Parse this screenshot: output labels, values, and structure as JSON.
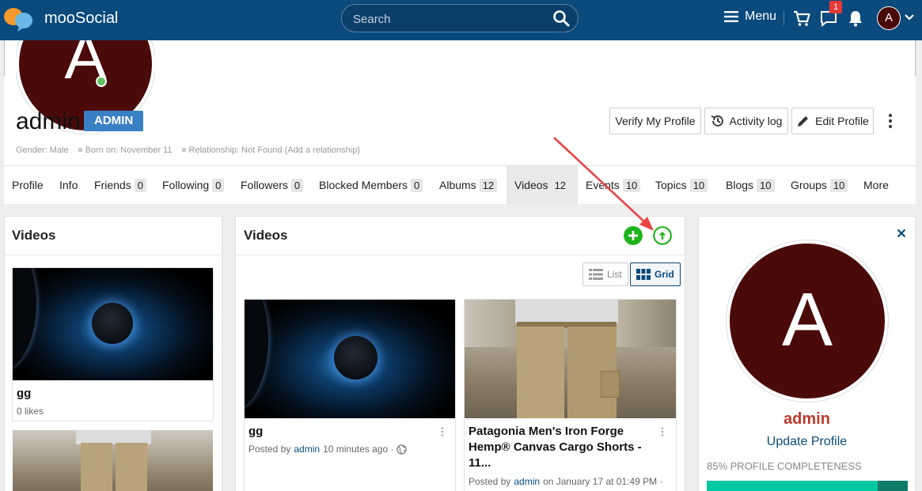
{
  "topbar": {
    "brand": "mooSocial",
    "search_placeholder": "Search",
    "menu_label": "Menu",
    "notification_count": "1",
    "avatar_letter": "A"
  },
  "profile": {
    "avatar_letter": "A",
    "name": "admin",
    "role": "ADMIN",
    "meta": {
      "gender": "Gender: Male",
      "born": "Born on: November 11",
      "relationship": "Relationship: Not Found (Add a relationship)"
    },
    "buttons": {
      "verify": "Verify My Profile",
      "activity": "Activity log",
      "edit": "Edit Profile"
    }
  },
  "tabs": [
    {
      "label": "Profile",
      "count": ""
    },
    {
      "label": "Info",
      "count": ""
    },
    {
      "label": "Friends",
      "count": "0"
    },
    {
      "label": "Following",
      "count": "0"
    },
    {
      "label": "Followers",
      "count": "0"
    },
    {
      "label": "Blocked Members",
      "count": "0"
    },
    {
      "label": "Albums",
      "count": "12"
    },
    {
      "label": "Videos",
      "count": "12"
    },
    {
      "label": "Events",
      "count": "10"
    },
    {
      "label": "Topics",
      "count": "10"
    },
    {
      "label": "Blogs",
      "count": "10"
    },
    {
      "label": "Groups",
      "count": "10"
    },
    {
      "label": "More",
      "count": ""
    }
  ],
  "left_panel": {
    "title": "Videos",
    "card1": {
      "title": "gg",
      "likes": "0 likes"
    }
  },
  "main_panel": {
    "title": "Videos",
    "view_list": "List",
    "view_grid": "Grid",
    "videos": [
      {
        "title": "gg",
        "posted_by": "Posted by",
        "author": "admin",
        "time": "10 minutes ago ·"
      },
      {
        "title": "Patagonia Men's Iron Forge Hemp® Canvas Cargo Shorts - 11...",
        "posted_by": "Posted by",
        "author": "admin",
        "time": "on January 17 at 01:49 PM ·"
      }
    ]
  },
  "right_panel": {
    "avatar_letter": "A",
    "name": "admin",
    "update_link": "Update Profile",
    "completeness": "85% PROFILE COMPLETENESS",
    "progress_percent": 85
  },
  "colors": {
    "topbar": "#0a4a7c",
    "badge": "#3a80c4",
    "green": "#1db31d",
    "avatar": "#4a0a0a",
    "progress": "#00c8a0"
  }
}
